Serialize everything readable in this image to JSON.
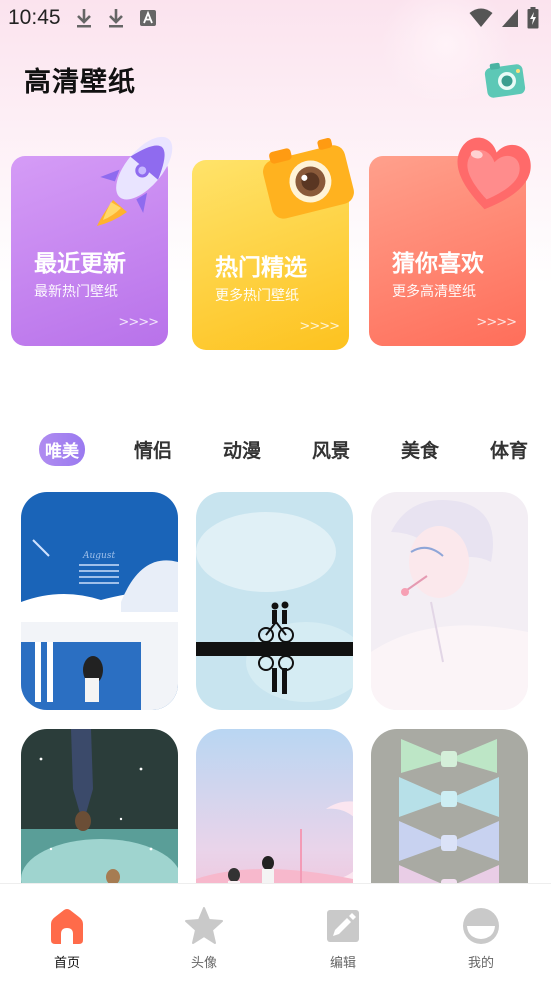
{
  "status_bar": {
    "time": "10:45",
    "notification_icons": [
      "download-icon",
      "download-icon",
      "app-a-icon"
    ],
    "system_icons": [
      "wifi-icon",
      "signal-icon",
      "battery-charging-icon"
    ]
  },
  "header": {
    "title": "高清壁纸",
    "action_icon": "camera-icon"
  },
  "feature_cards": [
    {
      "title": "最近更新",
      "subtitle": "最新热门壁纸",
      "arrows": ">>>>",
      "icon": "rocket-icon",
      "color": "#c585f0"
    },
    {
      "title": "热门精选",
      "subtitle": "更多热门壁纸",
      "arrows": ">>>>",
      "icon": "camera-icon",
      "color": "#fdcf38"
    },
    {
      "title": "猜你喜欢",
      "subtitle": "更多高清壁纸",
      "arrows": ">>>>",
      "icon": "heart-icon",
      "color": "#ff8370"
    }
  ],
  "category_tabs": [
    {
      "label": "唯美",
      "active": true
    },
    {
      "label": "情侣",
      "active": false
    },
    {
      "label": "动漫",
      "active": false
    },
    {
      "label": "风景",
      "active": false
    },
    {
      "label": "美食",
      "active": false
    },
    {
      "label": "体育",
      "active": false
    }
  ],
  "wallpapers": [
    {
      "name": "blue-calendar-girl"
    },
    {
      "name": "couple-bicycle-silhouette"
    },
    {
      "name": "anime-boy-lollipop"
    },
    {
      "name": "upside-down-boy-night"
    },
    {
      "name": "pink-sky-couple-moon"
    },
    {
      "name": "pastel-bows"
    }
  ],
  "bottom_nav": [
    {
      "label": "首页",
      "icon": "home-icon",
      "active": true
    },
    {
      "label": "头像",
      "icon": "star-icon",
      "active": false
    },
    {
      "label": "编辑",
      "icon": "edit-icon",
      "active": false
    },
    {
      "label": "我的",
      "icon": "profile-icon",
      "active": false
    }
  ],
  "colors": {
    "accent": "#9d7cf0",
    "nav_active": "#ff6b4a",
    "nav_inactive": "#c9c9c9"
  }
}
